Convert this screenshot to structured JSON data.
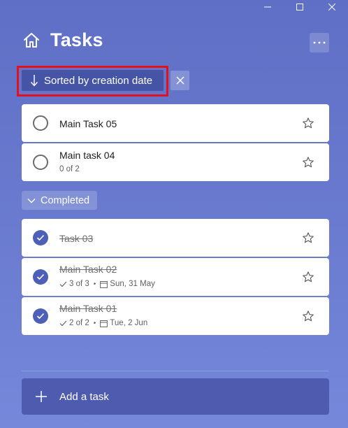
{
  "window": {
    "controls": [
      "minimize",
      "maximize",
      "close"
    ]
  },
  "header": {
    "title": "Tasks",
    "home_icon": "home-icon",
    "more_icon": "more-horizontal-icon"
  },
  "sort": {
    "label": "Sorted by creation date",
    "arrow_icon": "arrow-down-icon",
    "clear_icon": "close-icon"
  },
  "tasks": [
    {
      "title": "Main Task 05",
      "completed": false
    },
    {
      "title": "Main task 04",
      "completed": false,
      "steps": "0 of 2"
    }
  ],
  "completed_section": {
    "label": "Completed",
    "chevron_icon": "chevron-down-icon"
  },
  "completed_tasks": [
    {
      "title": "Task 03",
      "completed": true
    },
    {
      "title": "Main Task 02",
      "completed": true,
      "steps": "3 of 3",
      "due": "Sun, 31 May"
    },
    {
      "title": "Main Task 01",
      "completed": true,
      "steps": "2 of 2",
      "due": "Tue, 2 Jun"
    }
  ],
  "add_task": {
    "label": "Add a task",
    "icon": "plus-icon"
  },
  "colors": {
    "background_top": "#5f6fc5",
    "background_bottom": "#7588da",
    "accent": "#4d5fb7",
    "sort_button": "#4654a6",
    "highlight_border": "#e3111d"
  }
}
